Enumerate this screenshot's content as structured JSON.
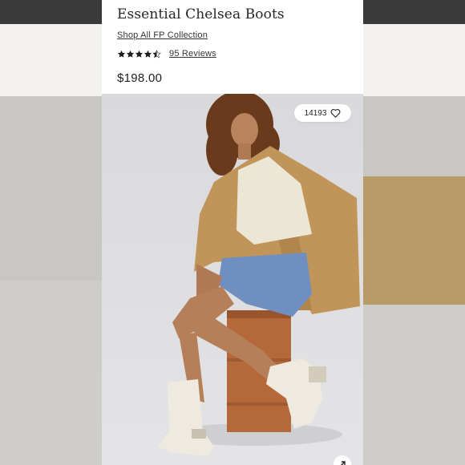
{
  "product": {
    "title": "Essential Chelsea Boots",
    "collection_link": "Shop All FP Collection",
    "rating_value": 4.5,
    "rating_max": 5,
    "reviews_link": "95 Reviews",
    "price": "$198.00"
  },
  "image": {
    "favorite_count": "14193",
    "favorite_icon": "heart-outline-icon",
    "expand_icon": "expand-arrow-icon"
  },
  "colors": {
    "background": "#e6e5e3",
    "photo_background": "#dcdcde",
    "text": "#262626"
  }
}
